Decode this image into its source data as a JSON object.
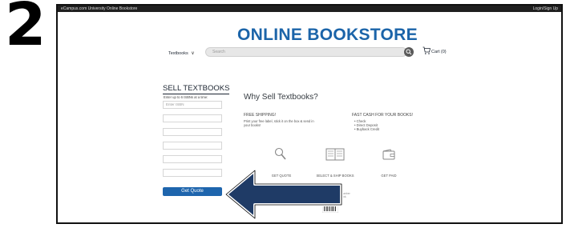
{
  "step_number": "2",
  "topbar": {
    "site_label": "eCampus.com University Online Bookstore",
    "account_link": "Login/Sign Up"
  },
  "header": {
    "logo_text": "ONLINE BOOKSTORE",
    "department_select": "Textbooks",
    "search_placeholder": "Search",
    "cart_label": "Cart (0)"
  },
  "sell_form": {
    "title": "SELL TEXTBOOKS",
    "subtitle": "Enter up to 6 ISBNs at a time:",
    "isbn_placeholder": "Enter ISBN",
    "isbn_field_count": 6,
    "button_label": "Get Quote"
  },
  "why_sell": {
    "title": "Why Sell Textbooks?",
    "free_shipping_heading": "FREE SHIPPING!",
    "free_shipping_text": "Print your free label, stick it on the box & send in your books!",
    "fast_cash_heading": "FAST CASH FOR YOUR BOOKS!",
    "fast_cash_options": [
      "Check",
      "Direct Deposit",
      "Buyback Credit"
    ],
    "steps": [
      {
        "icon": "magnifier-icon",
        "label": "GET QUOTE"
      },
      {
        "icon": "book-icon",
        "label": "SELECT & SHIP BOOKS"
      },
      {
        "icon": "wallet-icon",
        "label": "GET PAID"
      }
    ],
    "isbn_note": "The ISBN is the 10 or 13 digit number found on the back of your book."
  },
  "colors": {
    "brand_blue": "#1b64a9",
    "button_blue": "#1e65ad",
    "arrow_fill": "#1f3b66",
    "topbar": "#1f1f1f"
  }
}
